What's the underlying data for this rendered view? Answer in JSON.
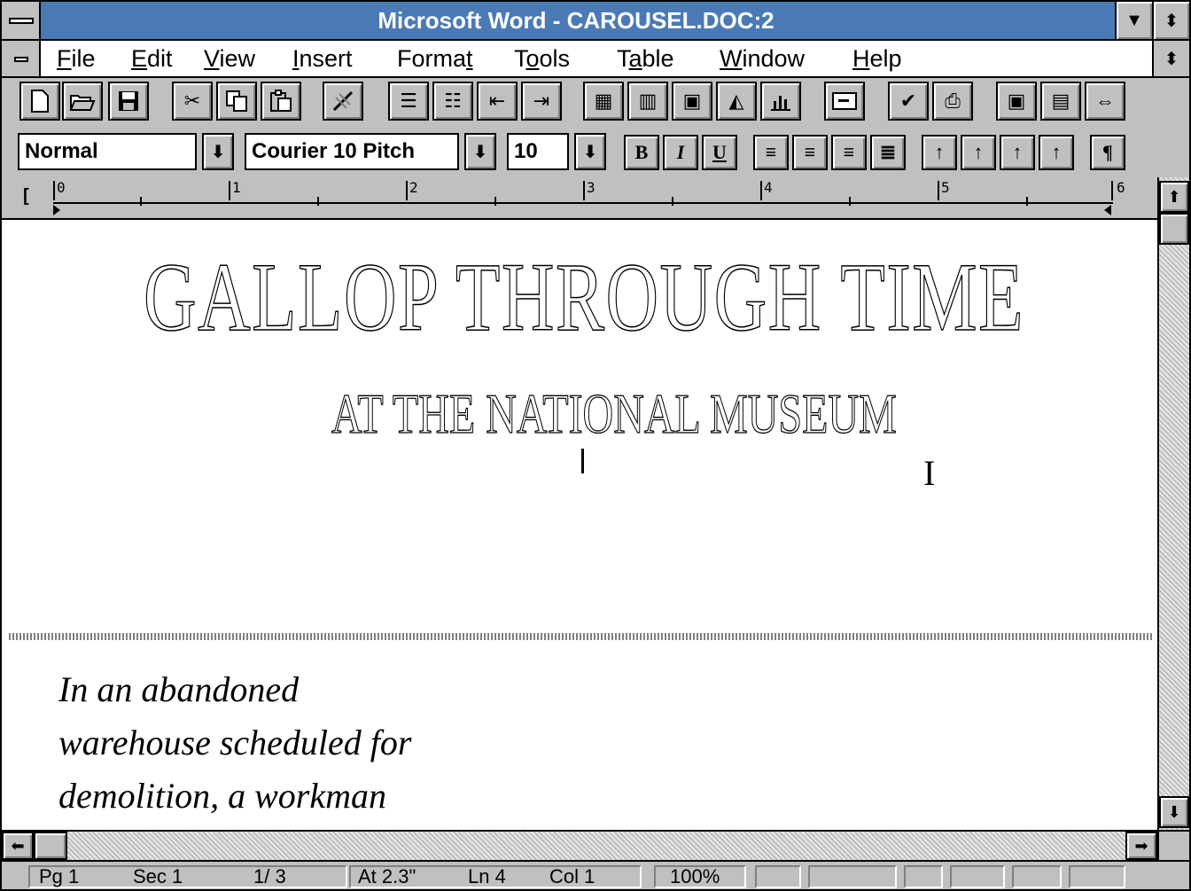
{
  "window": {
    "title": "Microsoft Word - CAROUSEL.DOC:2",
    "minimize_glyph": "▼",
    "restore_glyph": "⬍"
  },
  "menu": {
    "items": [
      {
        "label": "File",
        "accel": "F",
        "rest": "ile"
      },
      {
        "label": "Edit",
        "accel": "E",
        "rest": "dit"
      },
      {
        "label": "View",
        "accel": "V",
        "rest": "iew"
      },
      {
        "label": "Insert",
        "accel": "I",
        "rest": "nsert"
      },
      {
        "label": "Format",
        "pre": "Forma",
        "accel": "t",
        "rest": ""
      },
      {
        "label": "Tools",
        "pre": "T",
        "accel": "o",
        "rest": "ols"
      },
      {
        "label": "Table",
        "pre": "T",
        "accel": "a",
        "rest": "ble"
      },
      {
        "label": "Window",
        "accel": "W",
        "rest": "indow"
      },
      {
        "label": "Help",
        "accel": "H",
        "rest": "elp"
      }
    ]
  },
  "toolbar": {
    "icons": [
      "new-document-icon",
      "open-folder-icon",
      "save-disk-icon",
      "cut-scissors-icon",
      "copy-icon",
      "paste-icon",
      "format-painter-icon",
      "numbered-list-icon",
      "bulleted-list-icon",
      "unindent-icon",
      "indent-icon",
      "insert-table-icon",
      "columns-icon",
      "frame-icon",
      "drawing-icon",
      "chart-icon",
      "envelope-icon",
      "spelling-icon",
      "print-icon",
      "zoom-whole-page-icon",
      "zoom-normal-icon",
      "zoom-page-width-icon"
    ]
  },
  "formatting": {
    "style": "Normal",
    "font": "Courier 10 Pitch",
    "size": "10",
    "bold": "B",
    "italic": "I",
    "underline": "U",
    "paragraph_mark": "¶",
    "dropdown_glyph": "⬇"
  },
  "ruler": {
    "marker": "[",
    "numbers": [
      "0",
      "1",
      "2",
      "3",
      "4",
      "5",
      "6"
    ]
  },
  "document": {
    "heading1": "GALLOP THROUGH TIME",
    "heading2": "AT THE NATIONAL MUSEUM",
    "body_lines": [
      "In an abandoned",
      "warehouse scheduled for",
      "demolition, a workman"
    ]
  },
  "scrollbars": {
    "up": "⬆",
    "down": "⬇",
    "left": "⬅",
    "right": "➡"
  },
  "status": {
    "page": "Pg 1",
    "section": "Sec 1",
    "page_of": "1/ 3",
    "at": "At 2.3\"",
    "line": "Ln 4",
    "col": "Col 1",
    "zoom": "100%"
  }
}
